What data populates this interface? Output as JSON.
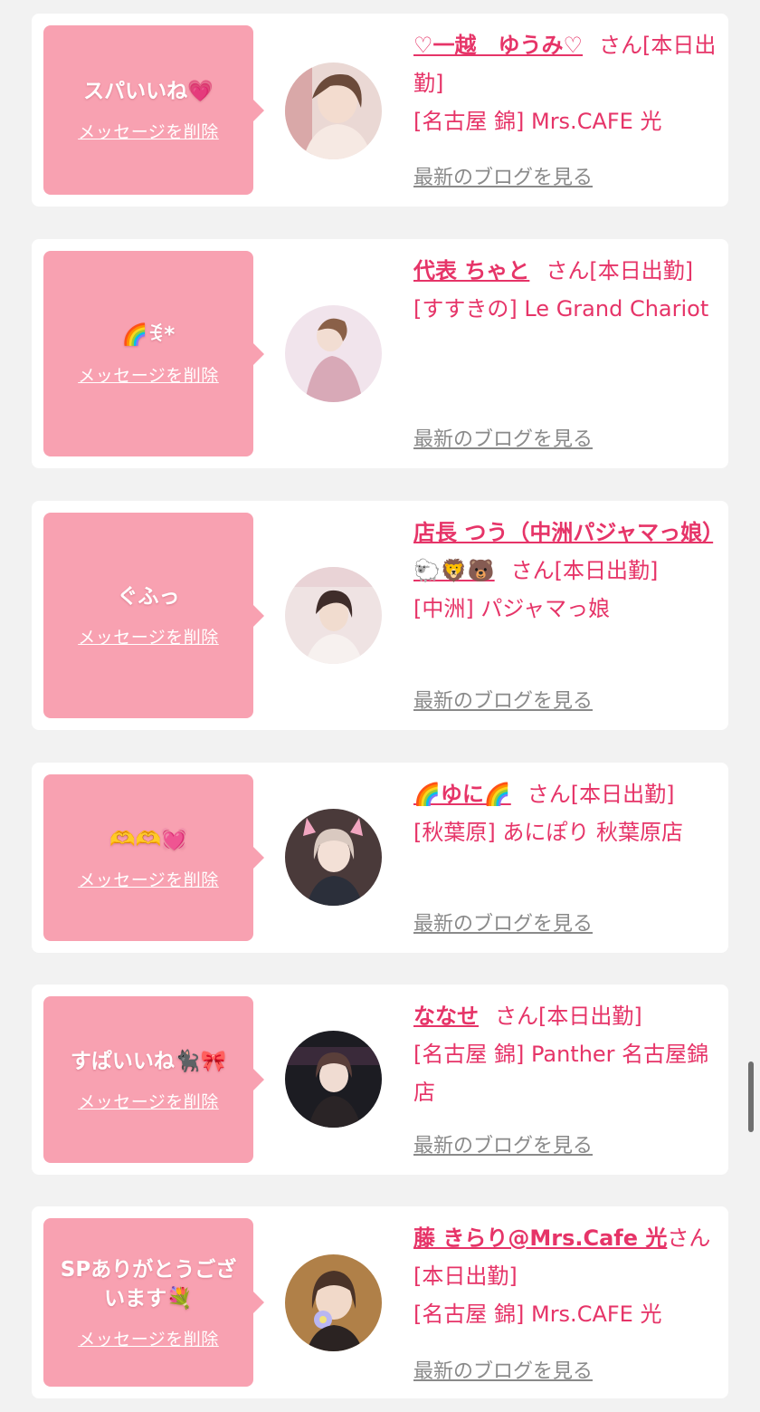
{
  "colors": {
    "accent": "#e63468",
    "bubble": "#f8a1b1",
    "link_gray": "#8a8a8a",
    "background": "#f2f2f2"
  },
  "items": [
    {
      "message": "スパいいね💗",
      "delete_label": "メッセージを削除",
      "name": "♡一越　ゆうみ♡",
      "san": "さん",
      "status": "[本日出勤]",
      "shop": "[名古屋 錦] Mrs.CAFE 光",
      "blog_label": "最新のブログを見る"
    },
    {
      "message": "🌈ꉂ*",
      "delete_label": "メッセージを削除",
      "name": "代表 ちゃと",
      "san": "さん",
      "status": "[本日出勤]",
      "shop": "[すすきの] Le Grand Chariot",
      "blog_label": "最新のブログを見る"
    },
    {
      "message": "ぐふっ",
      "delete_label": "メッセージを削除",
      "name": "店長 つう（中洲パジャマっ娘）🐑🦁🐻",
      "san": "さん",
      "status": "[本日出勤]",
      "shop": "[中洲] パジャマっ娘",
      "blog_label": "最新のブログを見る"
    },
    {
      "message": "🫶🫶💓",
      "delete_label": "メッセージを削除",
      "name": "🌈ゆに🌈",
      "san": "さん",
      "status": "[本日出勤]",
      "shop": "[秋葉原] あにぽり 秋葉原店",
      "blog_label": "最新のブログを見る"
    },
    {
      "message": "すぱいいね🐈‍⬛🎀",
      "delete_label": "メッセージを削除",
      "name": "ななせ",
      "san": "さん",
      "status": "[本日出勤]",
      "shop": "[名古屋 錦] Panther 名古屋錦店",
      "blog_label": "最新のブログを見る"
    },
    {
      "message": "SPありがとうございます💐",
      "delete_label": "メッセージを削除",
      "name": "藤 きらり@Mrs.Cafe 光",
      "san": "さん",
      "status": "[本日出勤]",
      "shop": "[名古屋 錦] Mrs.CAFE 光",
      "blog_label": "最新のブログを見る"
    }
  ]
}
